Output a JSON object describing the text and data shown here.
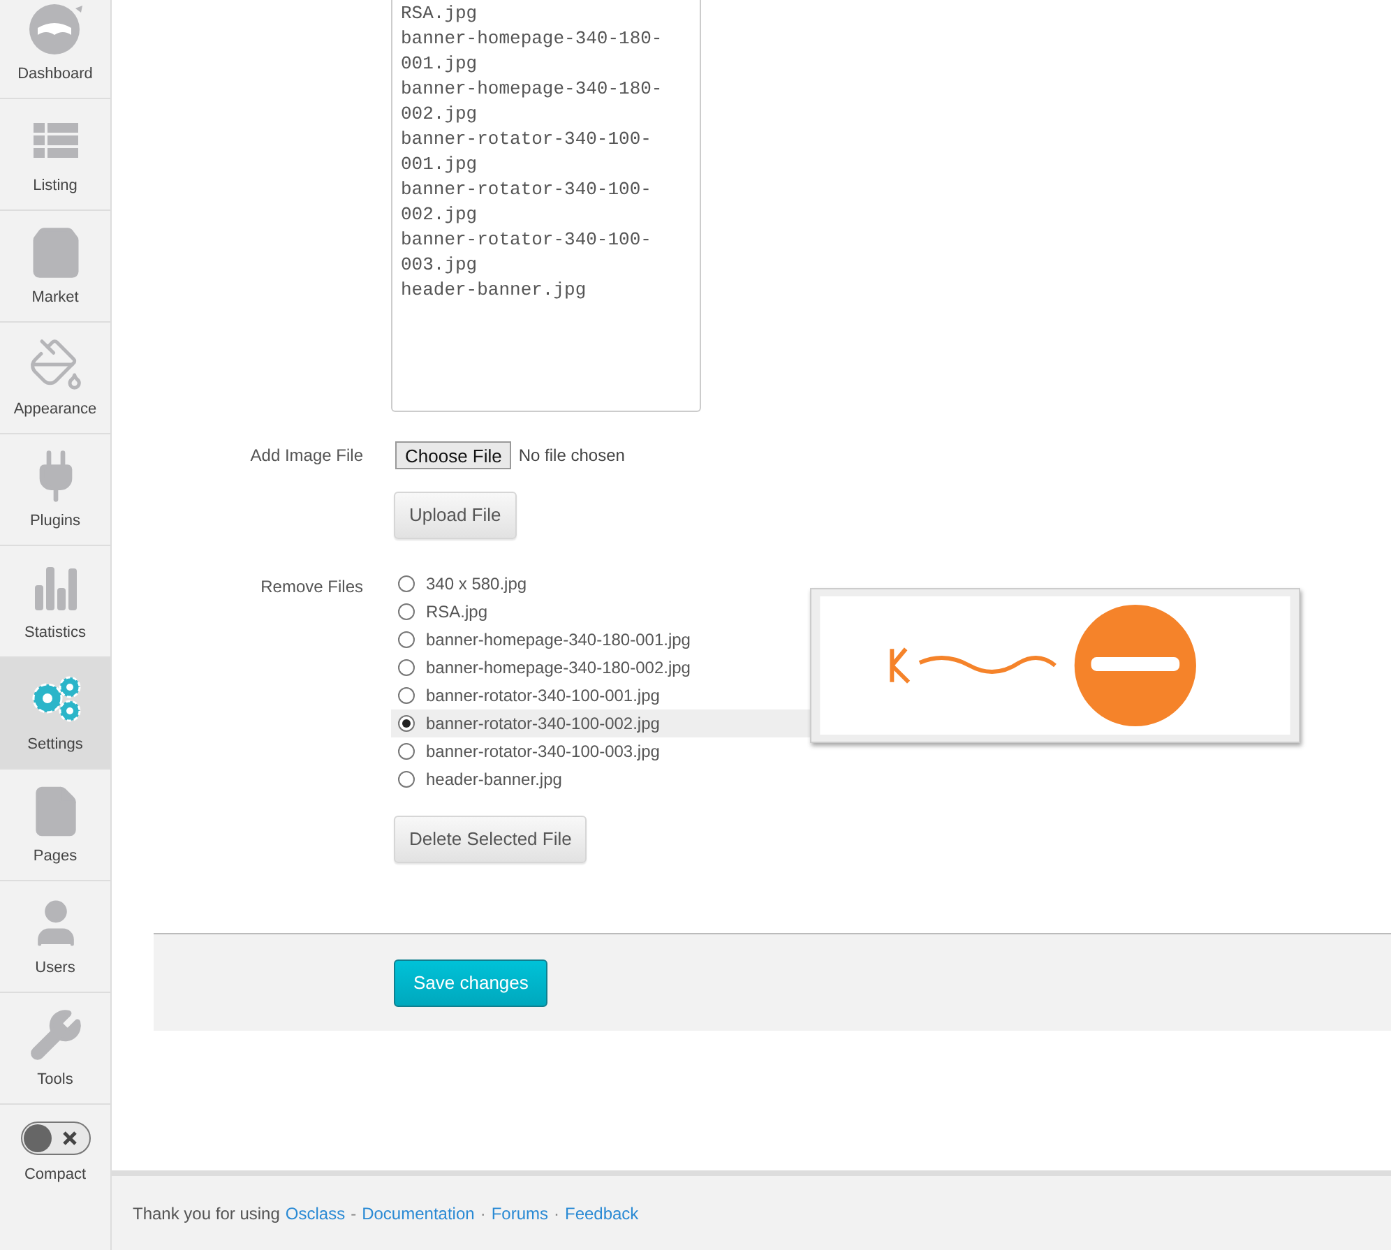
{
  "sidebar": {
    "items": [
      {
        "label": "Dashboard",
        "selected": false
      },
      {
        "label": "Listing",
        "selected": false
      },
      {
        "label": "Market",
        "selected": false
      },
      {
        "label": "Appearance",
        "selected": false
      },
      {
        "label": "Plugins",
        "selected": false
      },
      {
        "label": "Statistics",
        "selected": false
      },
      {
        "label": "Settings",
        "selected": true
      },
      {
        "label": "Pages",
        "selected": false
      },
      {
        "label": "Users",
        "selected": false
      },
      {
        "label": "Tools",
        "selected": false
      }
    ],
    "compact": {
      "label": "Compact",
      "on": false
    }
  },
  "file_list": [
    "RSA.jpg",
    "banner-homepage-340-180-001.jpg",
    "banner-homepage-340-180-002.jpg",
    "banner-rotator-340-100-001.jpg",
    "banner-rotator-340-100-002.jpg",
    "banner-rotator-340-100-003.jpg",
    "header-banner.jpg"
  ],
  "add_image": {
    "label": "Add Image File",
    "choose_button": "Choose File",
    "status": "No file chosen",
    "upload_button": "Upload File"
  },
  "remove_files": {
    "label": "Remove Files",
    "files": [
      {
        "name": "340 x 580.jpg",
        "selected": false
      },
      {
        "name": "RSA.jpg",
        "selected": false
      },
      {
        "name": "banner-homepage-340-180-001.jpg",
        "selected": false
      },
      {
        "name": "banner-homepage-340-180-002.jpg",
        "selected": false
      },
      {
        "name": "banner-rotator-340-100-001.jpg",
        "selected": false
      },
      {
        "name": "banner-rotator-340-100-002.jpg",
        "selected": true
      },
      {
        "name": "banner-rotator-340-100-003.jpg",
        "selected": false
      },
      {
        "name": "header-banner.jpg",
        "selected": false
      }
    ],
    "delete_button": "Delete Selected File"
  },
  "save_button": "Save changes",
  "footer": {
    "text": "Thank you for using",
    "links": [
      "Osclass",
      "Documentation",
      "Forums",
      "Feedback"
    ],
    "separators": [
      "-",
      "·",
      "·"
    ]
  }
}
